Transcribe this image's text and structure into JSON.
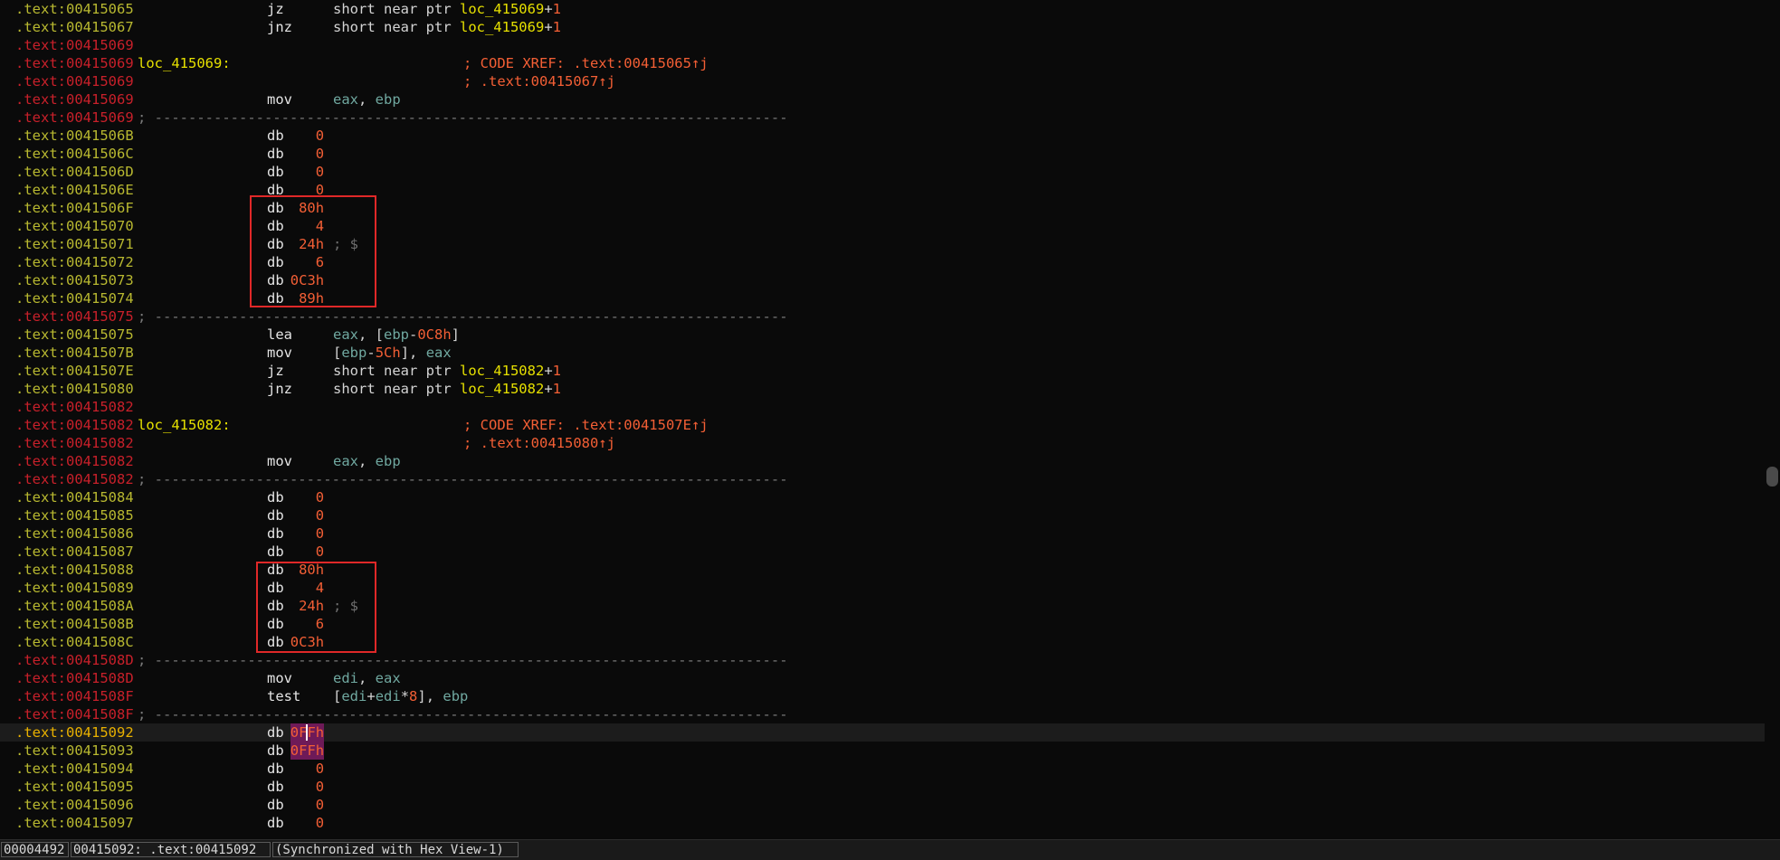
{
  "listing": {
    "lines": [
      {
        "addr": ".text:00415065",
        "type": "code",
        "mn": "jz",
        "ops": [
          {
            "t": "short near ptr ",
            "c": "plain"
          },
          {
            "t": "loc_415069",
            "c": "name"
          },
          {
            "t": "+",
            "c": "plain"
          },
          {
            "t": "1",
            "c": "num"
          }
        ]
      },
      {
        "addr": ".text:00415067",
        "type": "code",
        "mn": "jnz",
        "ops": [
          {
            "t": "short near ptr ",
            "c": "plain"
          },
          {
            "t": "loc_415069",
            "c": "name"
          },
          {
            "t": "+",
            "c": "plain"
          },
          {
            "t": "1",
            "c": "num"
          }
        ]
      },
      {
        "addr": ".text:00415069",
        "type": "label"
      },
      {
        "addr": ".text:00415069",
        "type": "label",
        "label": "loc_415069:",
        "xref": "; CODE XREF: .text:00415065↑j"
      },
      {
        "addr": ".text:00415069",
        "type": "label",
        "xref": "; .text:00415067↑j"
      },
      {
        "addr": ".text:00415069",
        "type": "label",
        "mn": "mov",
        "ops": [
          {
            "t": "eax",
            "c": "reg"
          },
          {
            "t": ", ",
            "c": "plain"
          },
          {
            "t": "ebp",
            "c": "reg"
          }
        ]
      },
      {
        "addr": ".text:00415069",
        "type": "label",
        "sep": "; ---------------------------------------------------------------------------"
      },
      {
        "addr": ".text:0041506B",
        "type": "code",
        "mn": "db",
        "val": "0"
      },
      {
        "addr": ".text:0041506C",
        "type": "code",
        "mn": "db",
        "val": "0"
      },
      {
        "addr": ".text:0041506D",
        "type": "code",
        "mn": "db",
        "val": "0"
      },
      {
        "addr": ".text:0041506E",
        "type": "code",
        "mn": "db",
        "val": "0"
      },
      {
        "addr": ".text:0041506F",
        "type": "code",
        "mn": "db",
        "val": "80h"
      },
      {
        "addr": ".text:00415070",
        "type": "code",
        "mn": "db",
        "val": "4"
      },
      {
        "addr": ".text:00415071",
        "type": "code",
        "mn": "db",
        "val": "24h",
        "cmt": "; $"
      },
      {
        "addr": ".text:00415072",
        "type": "code",
        "mn": "db",
        "val": "6"
      },
      {
        "addr": ".text:00415073",
        "type": "code",
        "mn": "db",
        "val": "0C3h"
      },
      {
        "addr": ".text:00415074",
        "type": "code",
        "mn": "db",
        "val": "89h"
      },
      {
        "addr": ".text:00415075",
        "type": "label",
        "sep": "; ---------------------------------------------------------------------------"
      },
      {
        "addr": ".text:00415075",
        "type": "code",
        "mn": "lea",
        "ops": [
          {
            "t": "eax",
            "c": "reg"
          },
          {
            "t": ", [",
            "c": "plain"
          },
          {
            "t": "ebp",
            "c": "reg"
          },
          {
            "t": "-",
            "c": "plain"
          },
          {
            "t": "0C8h",
            "c": "num"
          },
          {
            "t": "]",
            "c": "plain"
          }
        ]
      },
      {
        "addr": ".text:0041507B",
        "type": "code",
        "mn": "mov",
        "ops": [
          {
            "t": "[",
            "c": "plain"
          },
          {
            "t": "ebp",
            "c": "reg"
          },
          {
            "t": "-",
            "c": "plain"
          },
          {
            "t": "5Ch",
            "c": "num"
          },
          {
            "t": "], ",
            "c": "plain"
          },
          {
            "t": "eax",
            "c": "reg"
          }
        ]
      },
      {
        "addr": ".text:0041507E",
        "type": "code",
        "mn": "jz",
        "ops": [
          {
            "t": "short near ptr ",
            "c": "plain"
          },
          {
            "t": "loc_415082",
            "c": "name"
          },
          {
            "t": "+",
            "c": "plain"
          },
          {
            "t": "1",
            "c": "num"
          }
        ]
      },
      {
        "addr": ".text:00415080",
        "type": "code",
        "mn": "jnz",
        "ops": [
          {
            "t": "short near ptr ",
            "c": "plain"
          },
          {
            "t": "loc_415082",
            "c": "name"
          },
          {
            "t": "+",
            "c": "plain"
          },
          {
            "t": "1",
            "c": "num"
          }
        ]
      },
      {
        "addr": ".text:00415082",
        "type": "label"
      },
      {
        "addr": ".text:00415082",
        "type": "label",
        "label": "loc_415082:",
        "xref": "; CODE XREF: .text:0041507E↑j"
      },
      {
        "addr": ".text:00415082",
        "type": "label",
        "xref": "; .text:00415080↑j"
      },
      {
        "addr": ".text:00415082",
        "type": "label",
        "mn": "mov",
        "ops": [
          {
            "t": "eax",
            "c": "reg"
          },
          {
            "t": ", ",
            "c": "plain"
          },
          {
            "t": "ebp",
            "c": "reg"
          }
        ]
      },
      {
        "addr": ".text:00415082",
        "type": "label",
        "sep": "; ---------------------------------------------------------------------------"
      },
      {
        "addr": ".text:00415084",
        "type": "code",
        "mn": "db",
        "val": "0"
      },
      {
        "addr": ".text:00415085",
        "type": "code",
        "mn": "db",
        "val": "0"
      },
      {
        "addr": ".text:00415086",
        "type": "code",
        "mn": "db",
        "val": "0"
      },
      {
        "addr": ".text:00415087",
        "type": "code",
        "mn": "db",
        "val": "0"
      },
      {
        "addr": ".text:00415088",
        "type": "code",
        "mn": "db",
        "val": "80h"
      },
      {
        "addr": ".text:00415089",
        "type": "code",
        "mn": "db",
        "val": "4"
      },
      {
        "addr": ".text:0041508A",
        "type": "code",
        "mn": "db",
        "val": "24h",
        "cmt": "; $"
      },
      {
        "addr": ".text:0041508B",
        "type": "code",
        "mn": "db",
        "val": "6"
      },
      {
        "addr": ".text:0041508C",
        "type": "code",
        "mn": "db",
        "val": "0C3h"
      },
      {
        "addr": ".text:0041508D",
        "type": "label",
        "sep": "; ---------------------------------------------------------------------------"
      },
      {
        "addr": ".text:0041508D",
        "type": "label",
        "mn": "mov",
        "ops": [
          {
            "t": "edi",
            "c": "reg"
          },
          {
            "t": ", ",
            "c": "plain"
          },
          {
            "t": "eax",
            "c": "reg"
          }
        ]
      },
      {
        "addr": ".text:0041508F",
        "type": "label",
        "mn": "test",
        "ops": [
          {
            "t": "[",
            "c": "plain"
          },
          {
            "t": "edi",
            "c": "reg"
          },
          {
            "t": "+",
            "c": "plain"
          },
          {
            "t": "edi",
            "c": "reg"
          },
          {
            "t": "*",
            "c": "plain"
          },
          {
            "t": "8",
            "c": "num"
          },
          {
            "t": "], ",
            "c": "plain"
          },
          {
            "t": "ebp",
            "c": "reg"
          }
        ]
      },
      {
        "addr": ".text:0041508F",
        "type": "label",
        "sep": "; ---------------------------------------------------------------------------"
      },
      {
        "addr": ".text:00415092",
        "type": "current",
        "mn": "db",
        "val": "0FFh",
        "hl": true,
        "caret": true
      },
      {
        "addr": ".text:00415093",
        "type": "code",
        "mn": "db",
        "val": "0FFh",
        "hl": true
      },
      {
        "addr": ".text:00415094",
        "type": "code",
        "mn": "db",
        "val": "0"
      },
      {
        "addr": ".text:00415095",
        "type": "code",
        "mn": "db",
        "val": "0"
      },
      {
        "addr": ".text:00415096",
        "type": "code",
        "mn": "db",
        "val": "0"
      },
      {
        "addr": ".text:00415097",
        "type": "code",
        "mn": "db",
        "val": "0"
      }
    ]
  },
  "status": {
    "offset": "00004492",
    "location": "00415092: .text:00415092",
    "sync": "(Synchronized with Hex View-1)"
  },
  "colors": {
    "background": "#0a0a0a",
    "address_code": "#b8b830",
    "address_label": "#c8202a",
    "label_name": "#e6e000",
    "number": "#f45f35",
    "register": "#70a8a0",
    "annotation_box": "#e02828",
    "highlight": "#6e1a58"
  }
}
